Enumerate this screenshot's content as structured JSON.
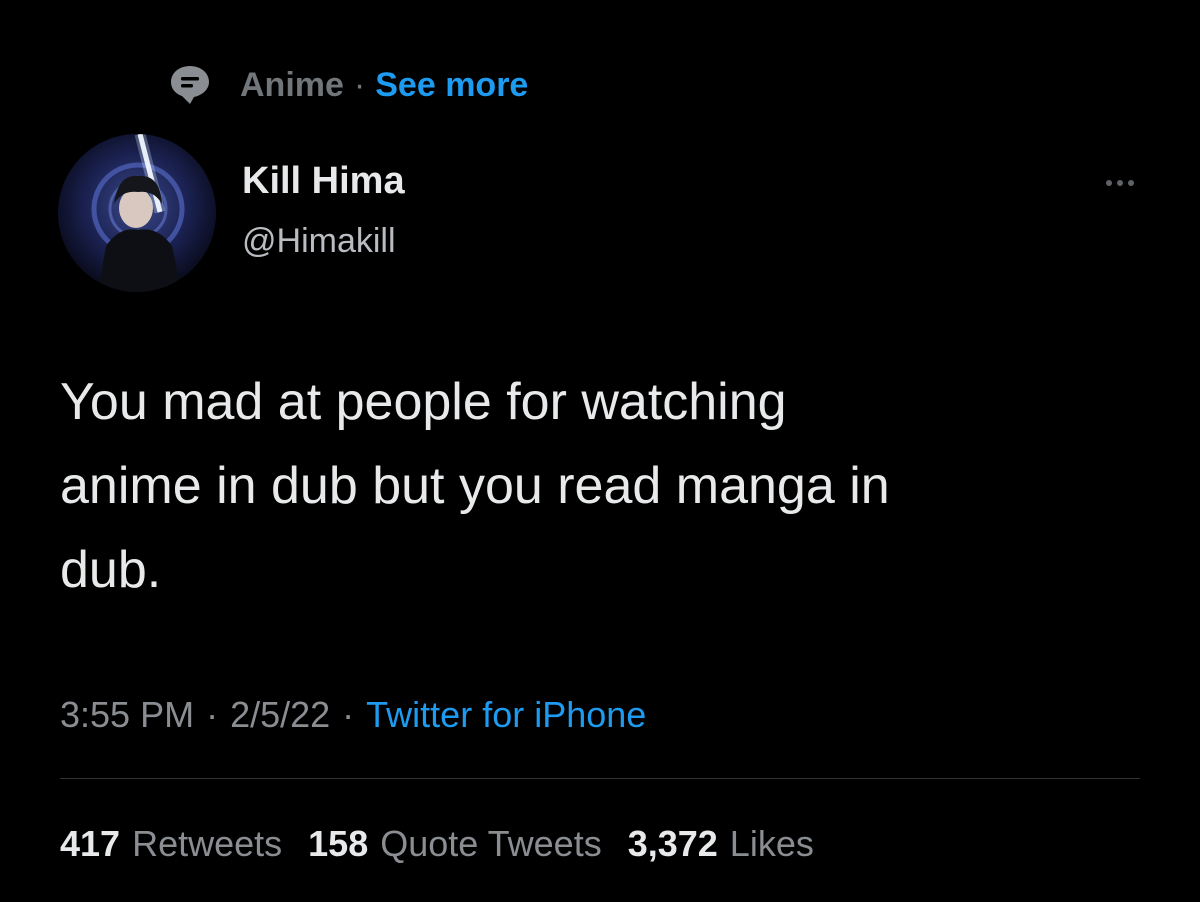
{
  "topic": {
    "icon": "topic-speech-bubble-icon",
    "label": "Anime",
    "separator": "·",
    "see_more": "See more"
  },
  "author": {
    "display_name": "Kill Hima",
    "handle": "@Himakill",
    "avatar": "anime-character-with-lightsaber-avatar"
  },
  "tweet": {
    "lines": [
      "You mad at people for watching",
      "anime in dub but you read manga in",
      "dub."
    ]
  },
  "meta": {
    "time": "3:55 PM",
    "sep1": "·",
    "date": "2/5/22",
    "sep2": "·",
    "source": "Twitter for iPhone"
  },
  "stats": [
    {
      "count": "417",
      "label": "Retweets"
    },
    {
      "count": "158",
      "label": "Quote Tweets"
    },
    {
      "count": "3,372",
      "label": "Likes"
    }
  ],
  "colors": {
    "background": "#000000",
    "primary_text": "#e7e9ea",
    "secondary_text": "#8a8d91",
    "accent_link": "#1d9bf0"
  }
}
